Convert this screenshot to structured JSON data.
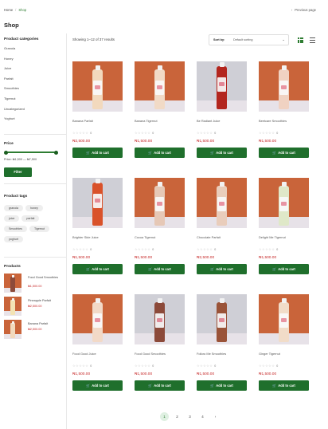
{
  "breadcrumb": {
    "home": "Home",
    "separator": "/",
    "current": "Shop"
  },
  "prev_page": {
    "icon": "chevron-left-icon",
    "label": "Previous page"
  },
  "page_title": "Shop",
  "sidebar": {
    "categories_title": "Product categories",
    "categories": [
      "Granola",
      "Honey",
      "Juice",
      "Parfait",
      "Smoothies",
      "Tigernut",
      "Uncategorized",
      "Yoghurt"
    ],
    "price_title": "Price",
    "price_range_text": "Price: ₦1,500 — ₦7,500",
    "price_range": {
      "min": 1500,
      "max": 7500,
      "selected_min": 1500,
      "selected_max": 7500
    },
    "filter_label": "Filter",
    "tags_title": "Product tags",
    "tags": [
      "granola",
      "honey",
      "juice",
      "parfait",
      "Smoothies",
      "Tigernut",
      "yoghurt"
    ],
    "products_title": "Products",
    "products": [
      {
        "name": "Food Good Smoothies",
        "price": "₦1,500.00"
      },
      {
        "name": "Pineapple Parfait",
        "price": "₦2,500.00"
      },
      {
        "name": "Banana Parfait",
        "price": "₦2,500.00"
      }
    ]
  },
  "toolbar": {
    "results_text": "Showing 1–12 of 37 results",
    "sort_label": "Sort by:",
    "sort_value": "Default sorting",
    "grid_view_icon": "grid-view-icon",
    "list_view_icon": "list-view-icon"
  },
  "products": [
    {
      "name": "Banana Parfait",
      "price": "₦2,500.00",
      "reviews": "0",
      "cart": "Add to cart",
      "bg": "#c9643a",
      "bottle": "#f2d9bd"
    },
    {
      "name": "Banana Tigernut",
      "price": "₦1,500.00",
      "reviews": "0",
      "cart": "Add to cart",
      "bg": "#c9643a",
      "bottle": "#f1dac6"
    },
    {
      "name": "Be Radiant Juice",
      "price": "₦1,500.00",
      "reviews": "0",
      "cart": "Add to cart",
      "bg": "#cfcfd6",
      "bottle": "#b3261e"
    },
    {
      "name": "Beetcare Smoothies",
      "price": "₦1,500.00",
      "reviews": "0",
      "cart": "Add to cart",
      "bg": "#c9643a",
      "bottle": "#f0d2c2"
    },
    {
      "name": "Brighter Side Juice",
      "price": "₦1,500.00",
      "reviews": "0",
      "cart": "Add to cart",
      "bg": "#cfcfd6",
      "bottle": "#d9522a"
    },
    {
      "name": "Cocoa Tigernut",
      "price": "₦1,500.00",
      "reviews": "0",
      "cart": "Add to cart",
      "bg": "#c9643a",
      "bottle": "#e6c8b6"
    },
    {
      "name": "Chocolate Parfait",
      "price": "₦2,500.00",
      "reviews": "0",
      "cart": "Add to cart",
      "bg": "#c9643a",
      "bottle": "#e9cdbb"
    },
    {
      "name": "Delight Me Tigernut",
      "price": "₦1,500.00",
      "reviews": "0",
      "cart": "Add to cart",
      "bg": "#c9643a",
      "bottle": "#dfe8c8"
    },
    {
      "name": "Food Good Juice",
      "price": "₦1,500.00",
      "reviews": "0",
      "cart": "Add to cart",
      "bg": "#c9643a",
      "bottle": "#f2d9c7"
    },
    {
      "name": "Food Good Smoothies",
      "price": "₦1,500.00",
      "reviews": "0",
      "cart": "Add to cart",
      "bg": "#cfcfd6",
      "bottle": "#8c4a3a"
    },
    {
      "name": "Follow Me Smoothies",
      "price": "₦1,500.00",
      "reviews": "0",
      "cart": "Add to cart",
      "bg": "#cfcfd6",
      "bottle": "#9a5338"
    },
    {
      "name": "Ginger Tigernut",
      "price": "₦1,500.00",
      "reviews": "0",
      "cart": "Add to cart",
      "bg": "#c9643a",
      "bottle": "#f1dcc8"
    }
  ],
  "rating_stars": "☆☆☆☆☆",
  "pagination": {
    "pages": [
      "1",
      "2",
      "3",
      "4"
    ],
    "active": "1",
    "next_icon": "chevron-right-icon",
    "next_glyph": "›"
  },
  "colors": {
    "accent": "#1f6f2c",
    "price": "#c62828",
    "orange_backdrop": "#c9643a"
  }
}
